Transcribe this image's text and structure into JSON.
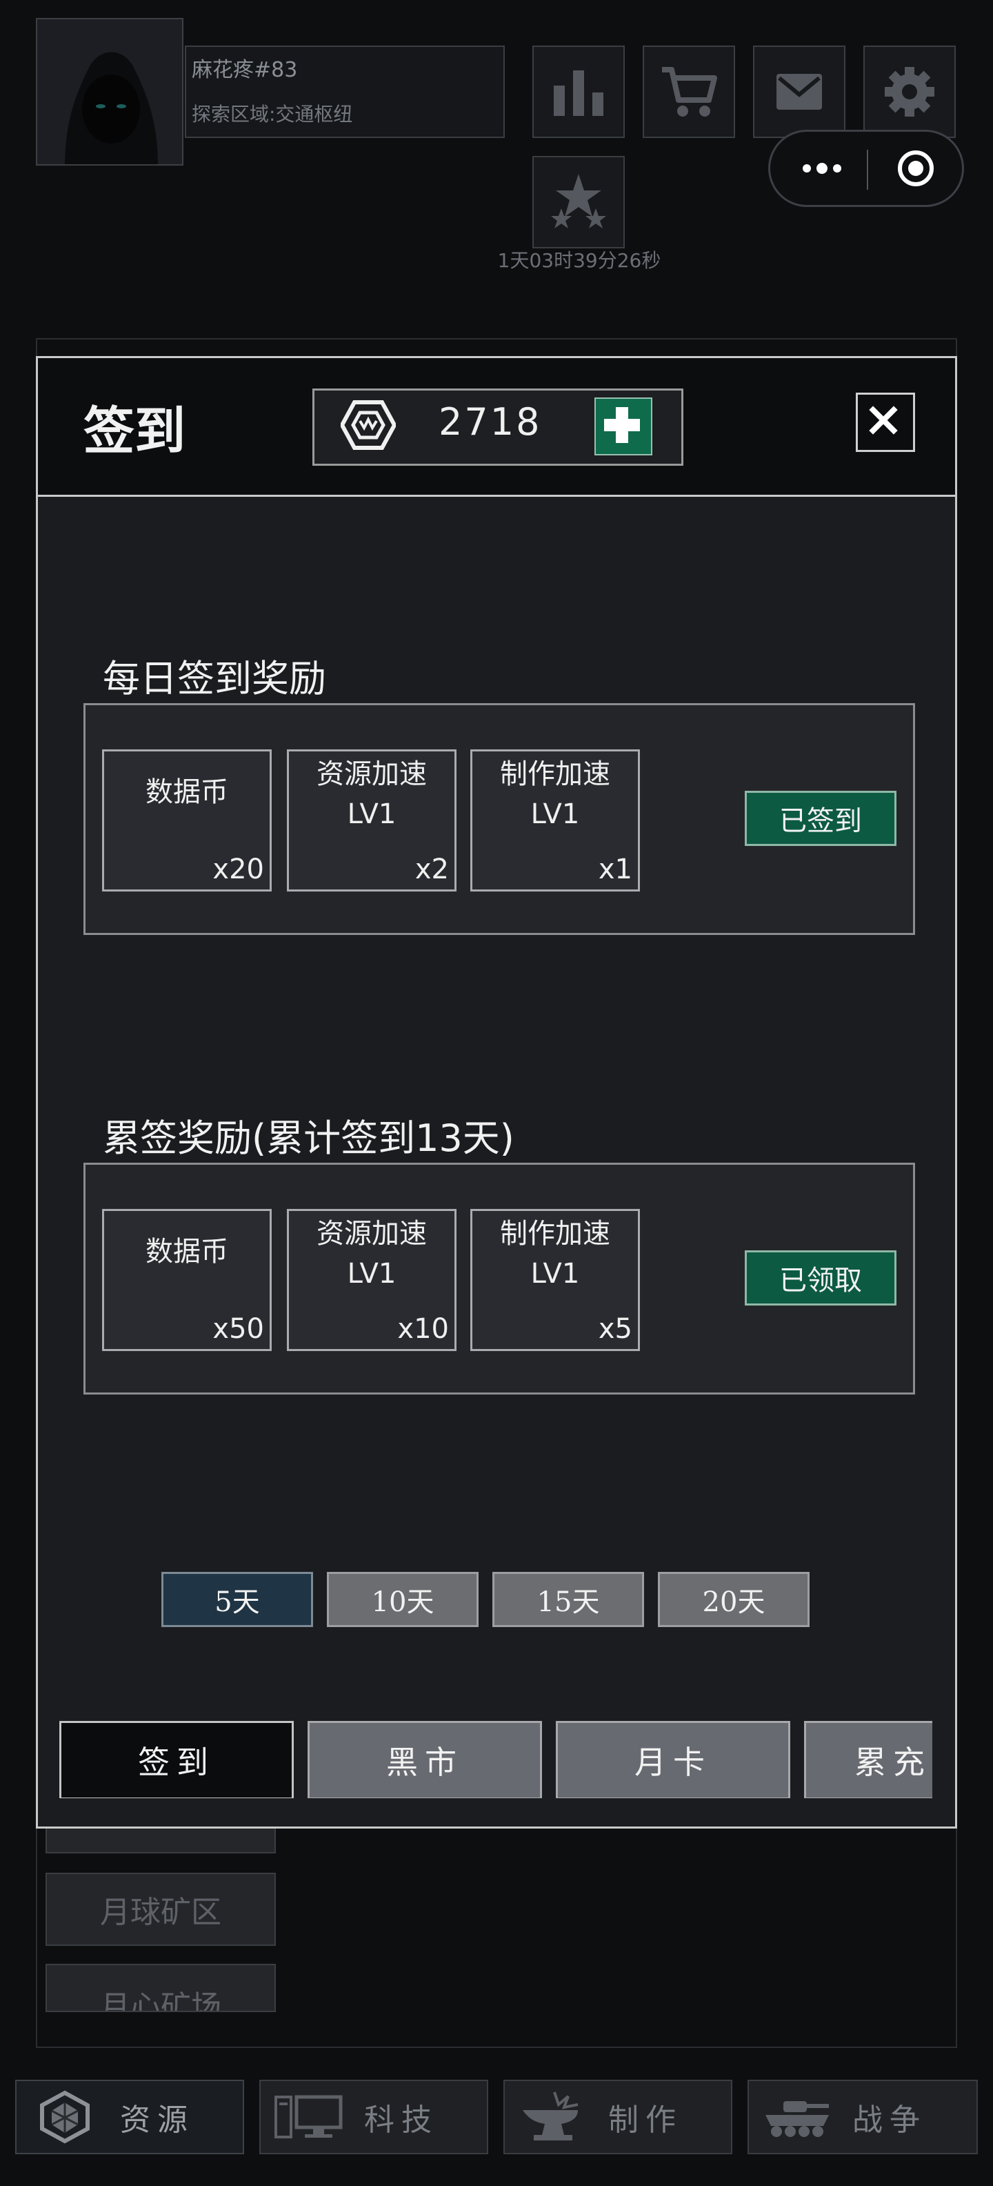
{
  "player": {
    "name": "麻花疼#83",
    "area": "探索区域:交通枢纽"
  },
  "header": {
    "timer": "1天03时39分26秒"
  },
  "background_list": {
    "items": [
      "月球矿区",
      "月心矿场"
    ]
  },
  "bottom_nav": [
    {
      "label": "资源",
      "icon": "gem-icon"
    },
    {
      "label": "科技",
      "icon": "computer-icon"
    },
    {
      "label": "制作",
      "icon": "anvil-icon"
    },
    {
      "label": "战争",
      "icon": "tank-icon"
    }
  ],
  "modal": {
    "title": "签到",
    "currency": {
      "value": "2718",
      "icon": "hexagon-coin-icon"
    },
    "daily": {
      "title": "每日签到奖励",
      "items": [
        {
          "name": "数据币",
          "qty": "x20"
        },
        {
          "name": "资源加速\nLV1",
          "qty": "x2"
        },
        {
          "name": "制作加速\nLV1",
          "qty": "x1"
        }
      ],
      "status": "已签到"
    },
    "cumulative": {
      "title": "累签奖励(累计签到13天)",
      "items": [
        {
          "name": "数据币",
          "qty": "x50"
        },
        {
          "name": "资源加速\nLV1",
          "qty": "x10"
        },
        {
          "name": "制作加速\nLV1",
          "qty": "x5"
        }
      ],
      "status": "已领取"
    },
    "day_tabs": [
      "5天",
      "10天",
      "15天",
      "20天"
    ],
    "tabs": [
      "签到",
      "黑市",
      "月卡",
      "累充奖"
    ]
  },
  "colors": {
    "accent_green": "#0d5a43",
    "active_day_tab": "#1f3444"
  }
}
